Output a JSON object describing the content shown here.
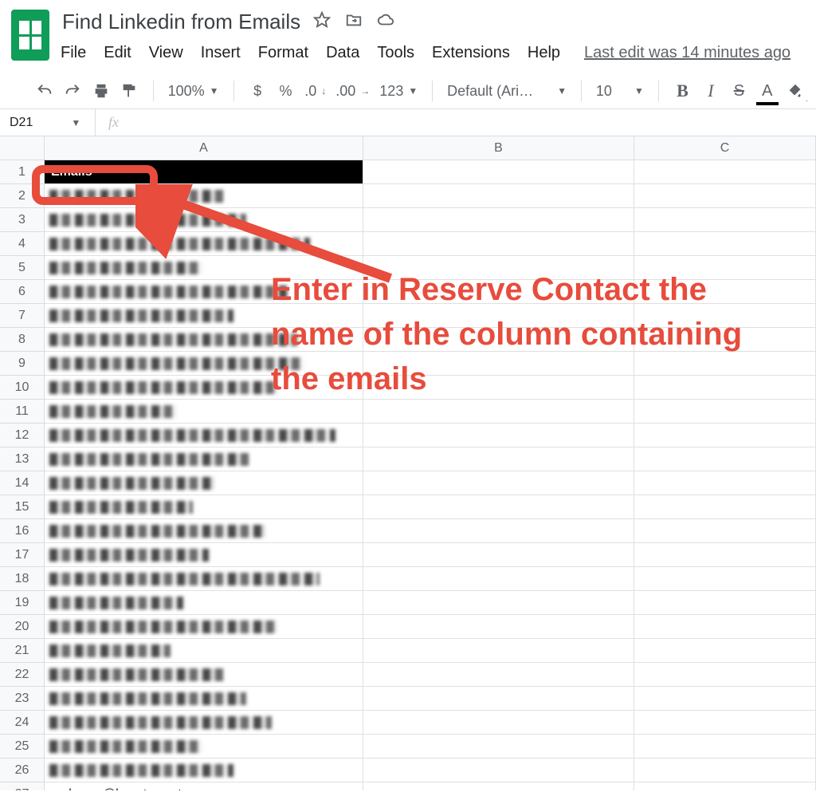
{
  "doc": {
    "title": "Find Linkedin from Emails",
    "last_edit": "Last edit was 14 minutes ago"
  },
  "menu": {
    "file": "File",
    "edit": "Edit",
    "view": "View",
    "insert": "Insert",
    "format": "Format",
    "data": "Data",
    "tools": "Tools",
    "extensions": "Extensions",
    "help": "Help"
  },
  "toolbar": {
    "zoom": "100%",
    "currency": "$",
    "percent": "%",
    "dec_dec": ".0",
    "inc_dec": ".00",
    "num_fmt": "123",
    "font": "Default (Ari…",
    "font_size": "10",
    "bold": "B",
    "italic": "I",
    "strike": "S",
    "textcolor": "A"
  },
  "namebox": {
    "ref": "D21"
  },
  "columns": [
    "A",
    "B",
    "C"
  ],
  "rows": [
    "1",
    "2",
    "3",
    "4",
    "5",
    "6",
    "7",
    "8",
    "9",
    "10",
    "11",
    "12",
    "13",
    "14",
    "15",
    "16",
    "17",
    "18",
    "19",
    "20",
    "21",
    "22",
    "23",
    "24",
    "25",
    "26",
    "27"
  ],
  "header_cell": "Emails",
  "visible_cell_27": "melmoez@havat.com.tr",
  "annotation": {
    "text": "Enter in Reserve Contact the name of the column containing the emails"
  },
  "colors": {
    "annotation": "#e74c3c",
    "sheets_green": "#0f9d58"
  }
}
